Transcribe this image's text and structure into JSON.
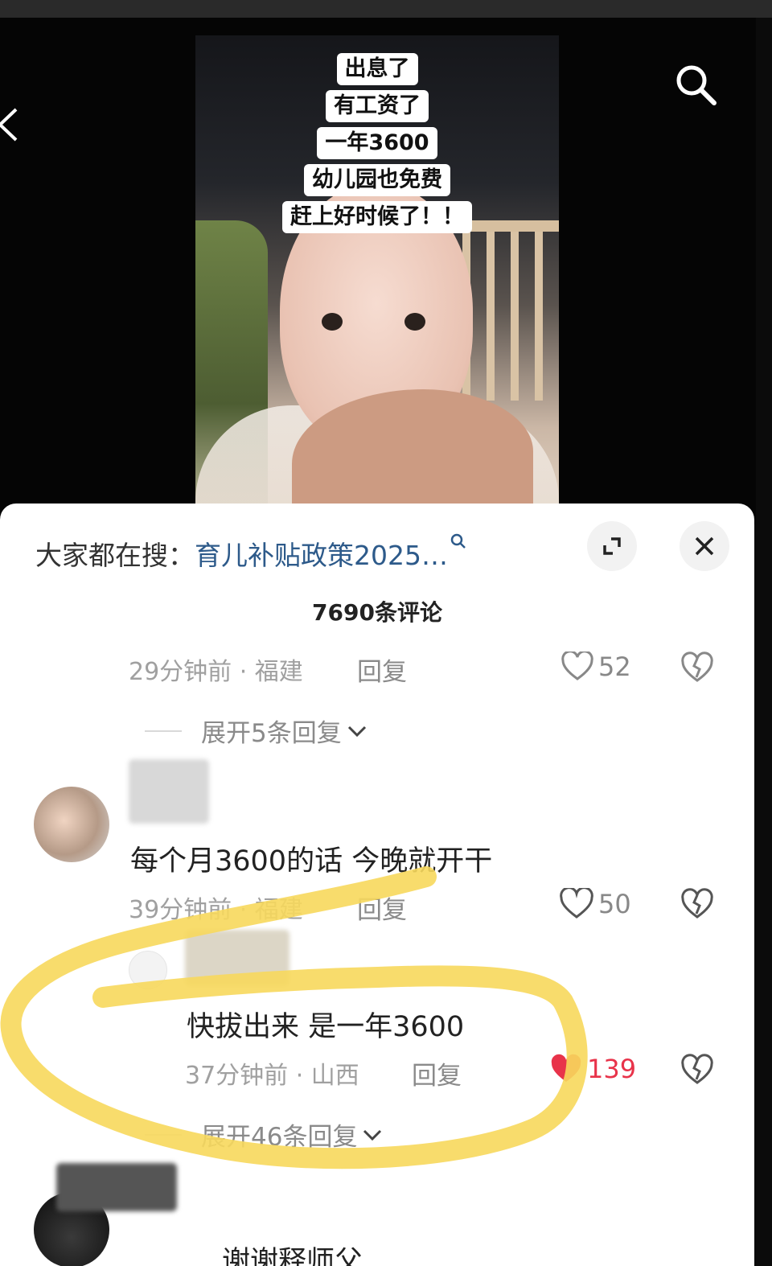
{
  "video": {
    "captions": [
      "出息了",
      "有工资了",
      "一年3600",
      "幼儿园也免费",
      "赶上好时候了！！"
    ]
  },
  "search_bar": {
    "prefix": "大家都在搜：",
    "query": "育儿补贴政策2025…"
  },
  "comment_count": "7690条评论",
  "comments": [
    {
      "time": "29分钟前",
      "location": "福建",
      "reply_label": "回复",
      "likes": "52",
      "expand_label": "展开5条回复"
    },
    {
      "text": "每个月3600的话 今晚就开干",
      "time": "39分钟前",
      "location": "福建",
      "reply_label": "回复",
      "likes": "50"
    },
    {
      "text": "快拔出来 是一年3600",
      "time": "37分钟前",
      "location": "山西",
      "reply_label": "回复",
      "likes": "139",
      "liked": true,
      "expand_label": "展开46条回复"
    },
    {
      "text": "谢谢释师父"
    }
  ],
  "colors": {
    "highlight": "#f7d85c",
    "liked_heart": "#e8334a",
    "link": "#2d5a8a"
  }
}
